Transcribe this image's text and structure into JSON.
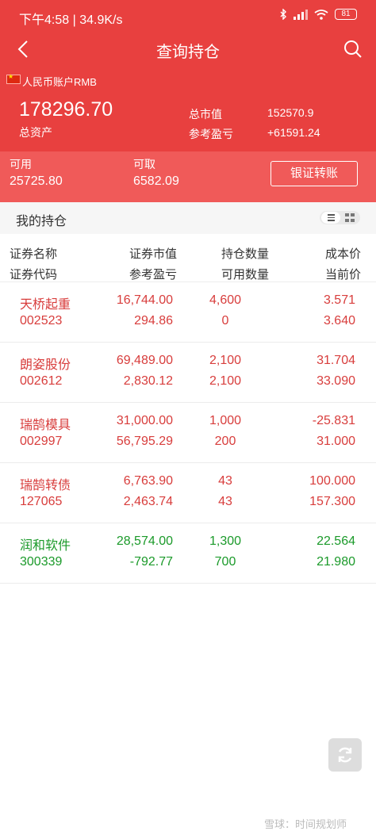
{
  "status_bar": {
    "time": "下午4:58",
    "speed": "34.9K/s",
    "battery": "81"
  },
  "nav": {
    "title": "查询持仓"
  },
  "summary": {
    "account": "人民币账户RMB",
    "total_assets_value": "178296.70",
    "total_assets_label": "总资产",
    "market_value_label": "总市值",
    "market_value": "152570.9",
    "ref_pl_label": "参考盈亏",
    "ref_pl": "+61591.24"
  },
  "funds": {
    "available_label": "可用",
    "available_value": "25725.80",
    "withdrawable_label": "可取",
    "withdrawable_value": "6582.09",
    "transfer_button": "银证转账"
  },
  "holdings": {
    "title": "我的持仓",
    "columns": {
      "name": "证券名称",
      "code": "证券代码",
      "market_value": "证券市值",
      "ref_pl": "参考盈亏",
      "qty": "持仓数量",
      "avail_qty": "可用数量",
      "cost": "成本价",
      "price": "当前价"
    },
    "rows": [
      {
        "name": "天桥起重",
        "code": "002523",
        "market_value": "16,744.00",
        "ref_pl": "294.86",
        "qty": "4,600",
        "avail_qty": "0",
        "cost": "3.571",
        "price": "3.640",
        "tone": "red"
      },
      {
        "name": "朗姿股份",
        "code": "002612",
        "market_value": "69,489.00",
        "ref_pl": "2,830.12",
        "qty": "2,100",
        "avail_qty": "2,100",
        "cost": "31.704",
        "price": "33.090",
        "tone": "red"
      },
      {
        "name": "瑞鹄模具",
        "code": "002997",
        "market_value": "31,000.00",
        "ref_pl": "56,795.29",
        "qty": "1,000",
        "avail_qty": "200",
        "cost": "-25.831",
        "price": "31.000",
        "tone": "red"
      },
      {
        "name": "瑞鹄转债",
        "code": "127065",
        "market_value": "6,763.90",
        "ref_pl": "2,463.74",
        "qty": "43",
        "avail_qty": "43",
        "cost": "100.000",
        "price": "157.300",
        "tone": "red"
      },
      {
        "name": "润和软件",
        "code": "300339",
        "market_value": "28,574.00",
        "ref_pl": "-792.77",
        "qty": "1,300",
        "avail_qty": "700",
        "cost": "22.564",
        "price": "21.980",
        "tone": "green"
      }
    ]
  },
  "watermark": "雪球：时间规划师",
  "colors": {
    "brand_red": "#e8403f",
    "funds_red": "#f05a59",
    "gain_red": "#d83d3c",
    "loss_green": "#1b9a2a"
  }
}
